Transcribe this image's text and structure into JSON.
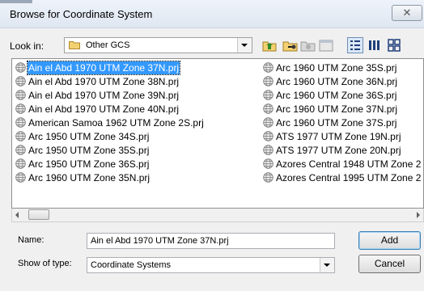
{
  "window": {
    "title": "Browse for Coordinate System",
    "close_glyph": "✕"
  },
  "lookin": {
    "label": "Look in:",
    "value": "Other GCS",
    "icon": "folder-icon"
  },
  "toolbar": {
    "icons": [
      "up-folder-icon",
      "connect-folder-icon",
      "disconnect-folder-icon",
      "properties-icon",
      "details-view-icon",
      "list-view-icon",
      "thumbnails-view-icon"
    ]
  },
  "files": {
    "column1": [
      "Ain el Abd 1970 UTM Zone 37N.prj",
      "Ain el Abd 1970 UTM Zone 38N.prj",
      "Ain el Abd 1970 UTM Zone 39N.prj",
      "Ain el Abd 1970 UTM Zone 40N.prj",
      "American Samoa 1962 UTM Zone 2S.prj",
      "Arc 1950 UTM Zone 34S.prj",
      "Arc 1950 UTM Zone 35S.prj",
      "Arc 1950 UTM Zone 36S.prj",
      "Arc 1960 UTM Zone 35N.prj"
    ],
    "column2": [
      "Arc 1960 UTM Zone 35S.prj",
      "Arc 1960 UTM Zone 36N.prj",
      "Arc 1960 UTM Zone 36S.prj",
      "Arc 1960 UTM Zone 37N.prj",
      "Arc 1960 UTM Zone 37S.prj",
      "ATS 1977 UTM Zone 19N.prj",
      "ATS 1977 UTM Zone 20N.prj",
      "Azores Central 1948 UTM Zone 2",
      "Azores Central 1995 UTM Zone 2"
    ],
    "selected": "Ain el Abd 1970 UTM Zone 37N.prj"
  },
  "name_field": {
    "label": "Name:",
    "value": "Ain el Abd 1970 UTM Zone 37N.prj"
  },
  "type_field": {
    "label": "Show of type:",
    "value": "Coordinate Systems"
  },
  "buttons": {
    "add": "Add",
    "cancel": "Cancel"
  },
  "colors": {
    "selection": "#3399ff",
    "window_bg": "#f0f0f0"
  }
}
